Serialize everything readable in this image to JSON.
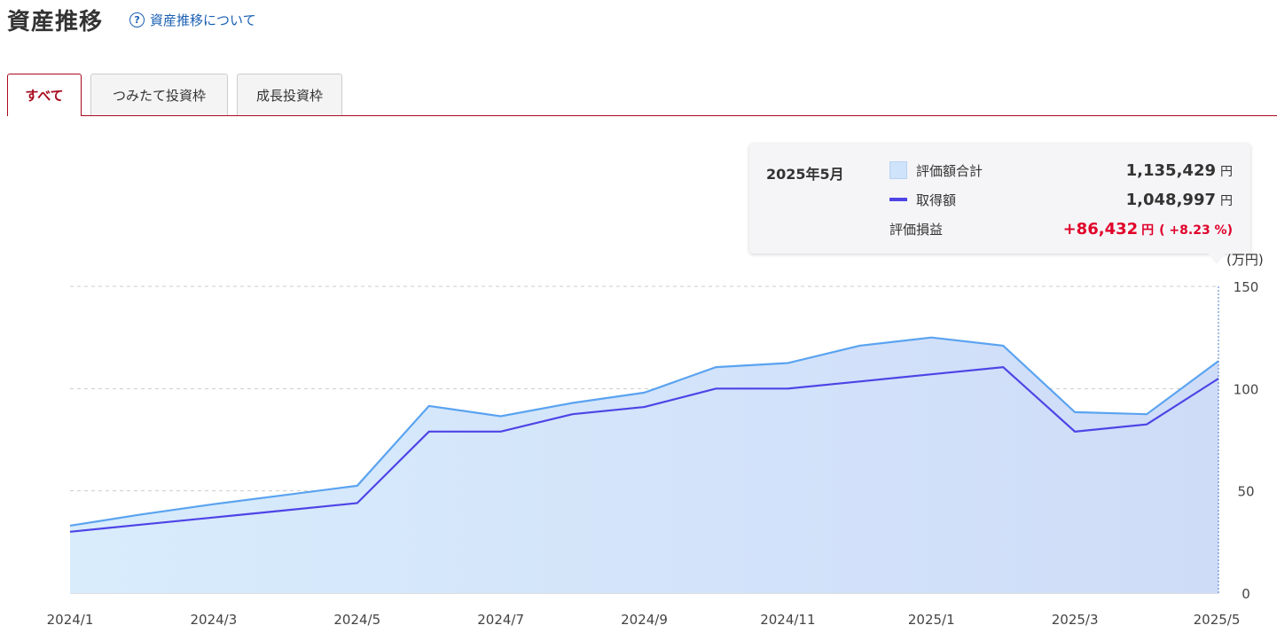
{
  "header": {
    "title": "資産推移",
    "help_label": "資産推移について",
    "help_icon": "question-circle-icon"
  },
  "tabs": [
    {
      "label": "すべて",
      "active": true
    },
    {
      "label": "つみたて投資枠",
      "active": false
    },
    {
      "label": "成長投資枠",
      "active": false
    }
  ],
  "tooltip": {
    "date": "2025年5月",
    "valuation_label": "評価額合計",
    "valuation_value": "1,135,429",
    "acquisition_label": "取得額",
    "acquisition_value": "1,048,997",
    "gain_label": "評価損益",
    "gain_value": "+86,432",
    "gain_pct": "( +8.23 %)",
    "unit": "円"
  },
  "colors": {
    "accent": "#a80b1e",
    "valuation_line": "#5aa3f0",
    "acquisition_line": "#4e44e6",
    "gain": "#e0002a"
  },
  "chart_data": {
    "type": "area",
    "y_unit": "(万円)",
    "ylim": [
      0,
      150
    ],
    "yticks": [
      "0",
      "50",
      "100",
      "150"
    ],
    "xticks": [
      "2024/1",
      "2024/3",
      "2024/5",
      "2024/7",
      "2024/9",
      "2024/11",
      "2025/1",
      "2025/3",
      "2025/5"
    ],
    "grid": true,
    "x": [
      "2024/1",
      "2024/2",
      "2024/3",
      "2024/4",
      "2024/5",
      "2024/6",
      "2024/7",
      "2024/8",
      "2024/9",
      "2024/10",
      "2024/11",
      "2024/12",
      "2025/1",
      "2025/2",
      "2025/3",
      "2025/4",
      "2025/5"
    ],
    "series": [
      {
        "name": "評価額合計",
        "style": "area",
        "values": [
          33,
          38.5,
          43.5,
          48,
          52.5,
          91.5,
          86.5,
          93,
          98,
          110.5,
          112.5,
          121,
          125,
          121,
          88.5,
          87.5,
          113.5
        ]
      },
      {
        "name": "取得額",
        "style": "line",
        "values": [
          30,
          33.5,
          37,
          40.5,
          44,
          79,
          79,
          87.5,
          91,
          100,
          100,
          103.5,
          107,
          110.5,
          79,
          82.5,
          104.9
        ]
      }
    ]
  }
}
